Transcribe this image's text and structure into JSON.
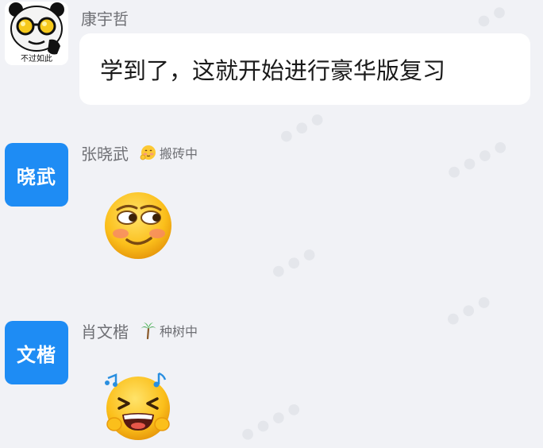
{
  "messages": [
    {
      "sender": "康宇哲",
      "avatar_caption": "不过如此",
      "text": "学到了，这就开始进行豪华版复习"
    },
    {
      "sender": "张晓武",
      "avatar_text": "晓武",
      "status_icon": "shy-face-icon",
      "status_text": "搬砖中",
      "sticker": "smirk-emoji"
    },
    {
      "sender": "肖文楷",
      "avatar_text": "文楷",
      "status_icon": "palm-tree-icon",
      "status_text": "种树中",
      "sticker": "laughing-with-music-emoji"
    }
  ],
  "colors": {
    "background": "#f1f2f6",
    "avatar_blue": "#1e8cf4",
    "bubble": "#ffffff",
    "name_gray": "#6f7075"
  }
}
